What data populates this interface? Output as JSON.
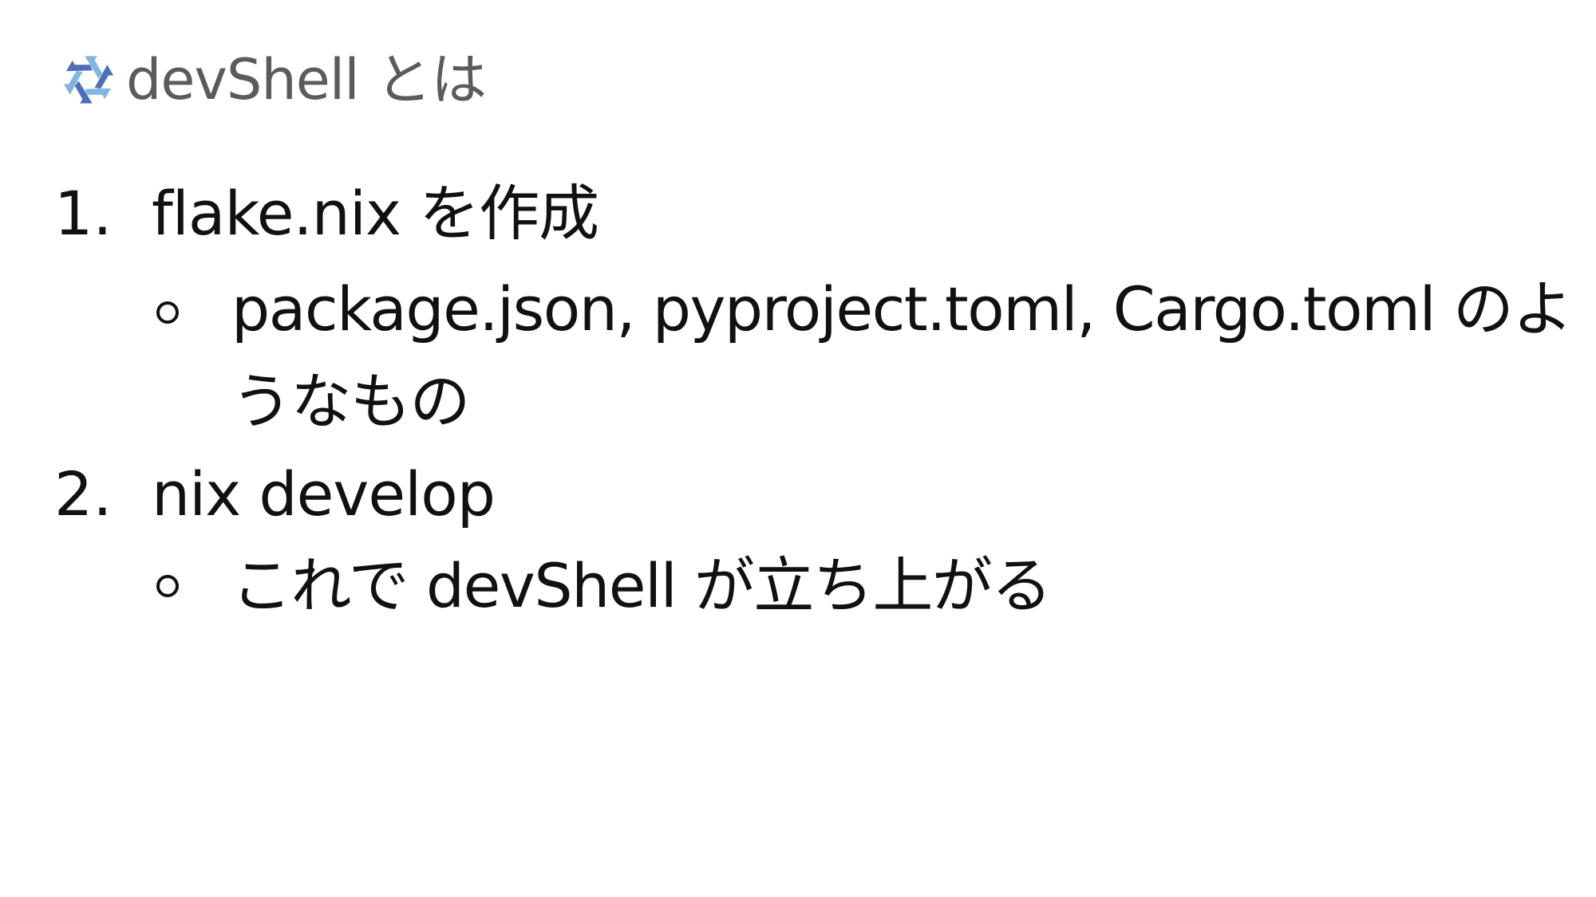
{
  "slide": {
    "title": "devShell とは",
    "logo_icon": "nix-snowflake-icon",
    "colors": {
      "title": "#5b5b5b",
      "text": "#111111",
      "logo_light": "#7eb6e4",
      "logo_dark": "#4e6fb8"
    },
    "items": [
      {
        "number": "1.",
        "text": "flake.nix を作成",
        "sub": "package.json, pyproject.toml, Cargo.toml のようなもの"
      },
      {
        "number": "2.",
        "text": "nix develop",
        "sub": "これで devShell が立ち上がる"
      }
    ]
  }
}
